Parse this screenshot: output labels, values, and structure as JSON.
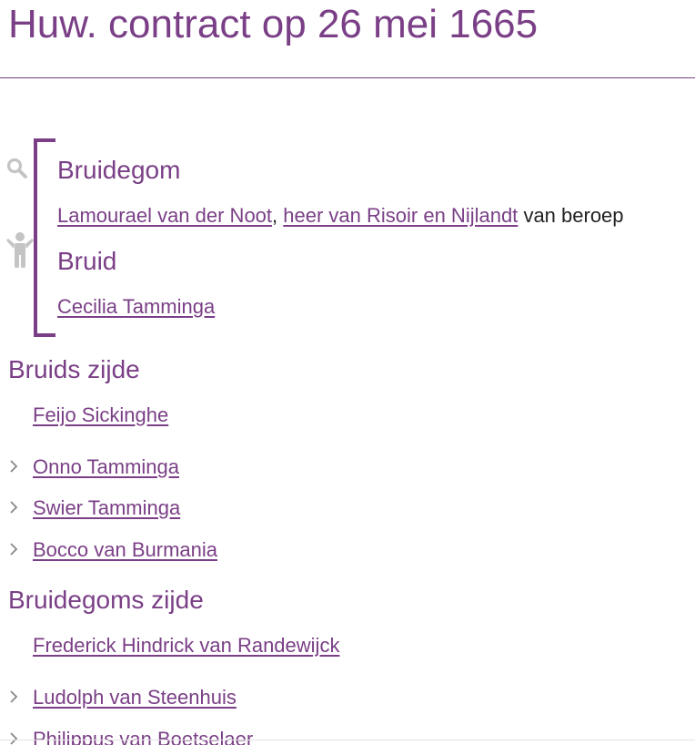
{
  "page": {
    "title": "Huw. contract op 26 mei 1665"
  },
  "icons": {
    "search": "search-icon",
    "person": "person-icon",
    "chevron": "chevron-right-icon"
  },
  "colors": {
    "accent": "#7a3f86",
    "icon_gray": "#c4c4c4"
  },
  "groom": {
    "heading": "Bruidegom",
    "name": "Lamourael van der Noot",
    "separator": ",",
    "title_link": "heer van Risoir en Nijlandt",
    "profession_suffix": "van beroep"
  },
  "bride": {
    "heading": "Bruid",
    "name": "Cecilia Tamminga"
  },
  "bride_side": {
    "heading": "Bruids zijde",
    "people": [
      "Feijo Sickinghe",
      "Onno Tamminga",
      "Swier Tamminga",
      "Bocco van Burmania"
    ]
  },
  "groom_side": {
    "heading": "Bruidegoms zijde",
    "people": [
      "Frederick Hindrick van Randewijck",
      "Ludolph van Steenhuis",
      "Philippus van Boetselaer"
    ]
  }
}
